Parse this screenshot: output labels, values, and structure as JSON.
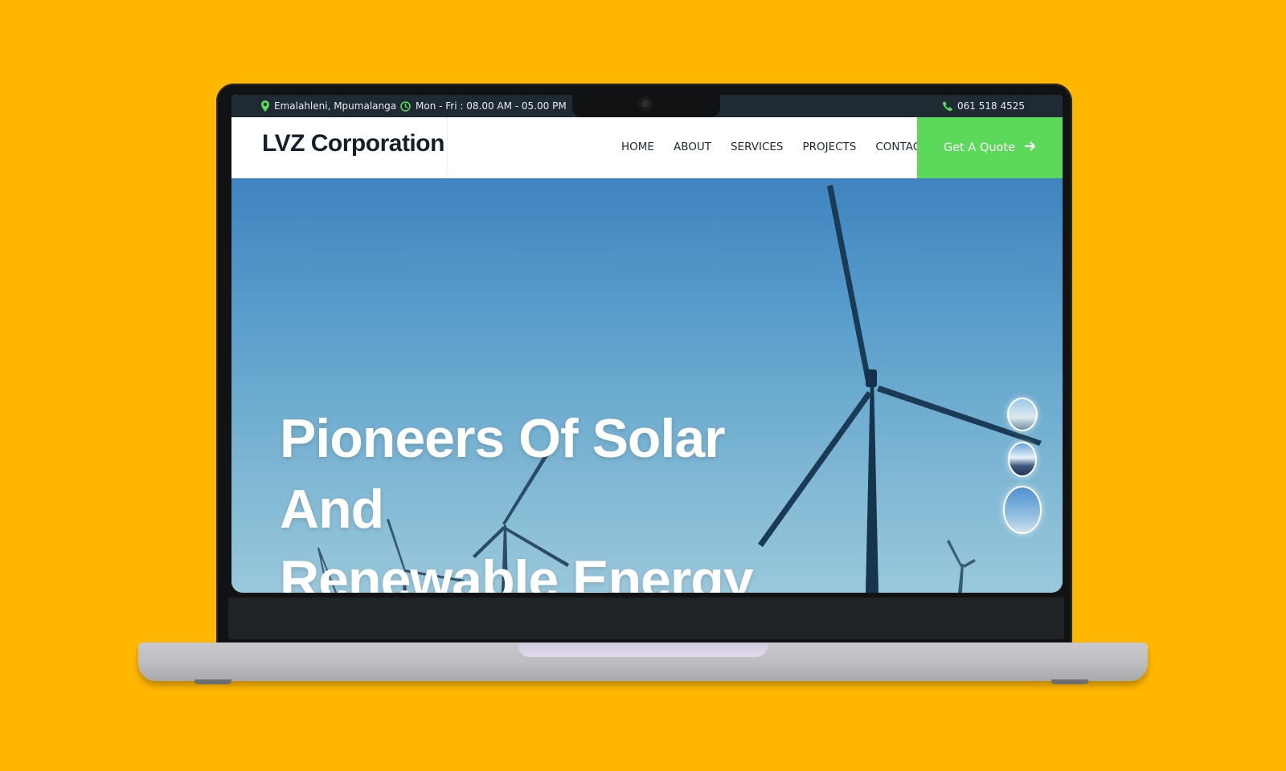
{
  "topbar": {
    "location": "Emalahleni, Mpumalanga",
    "hours": "Mon - Fri : 08.00 AM - 05.00 PM",
    "phone": "061 518 4525"
  },
  "header": {
    "brand": "LVZ Corporation",
    "nav": [
      "HOME",
      "ABOUT",
      "SERVICES",
      "PROJECTS",
      "CONTACT"
    ],
    "cta_label": "Get A Quote"
  },
  "hero": {
    "title_line1": "Pioneers Of Solar And",
    "title_line2": "Renewable Energy"
  },
  "colors": {
    "background": "#FFB700",
    "accent_green": "#5CD85A",
    "topbar": "#1F2A33",
    "brand_text": "#13202C"
  },
  "icons": [
    "map-pin-icon",
    "clock-icon",
    "phone-icon",
    "arrow-right-icon"
  ]
}
